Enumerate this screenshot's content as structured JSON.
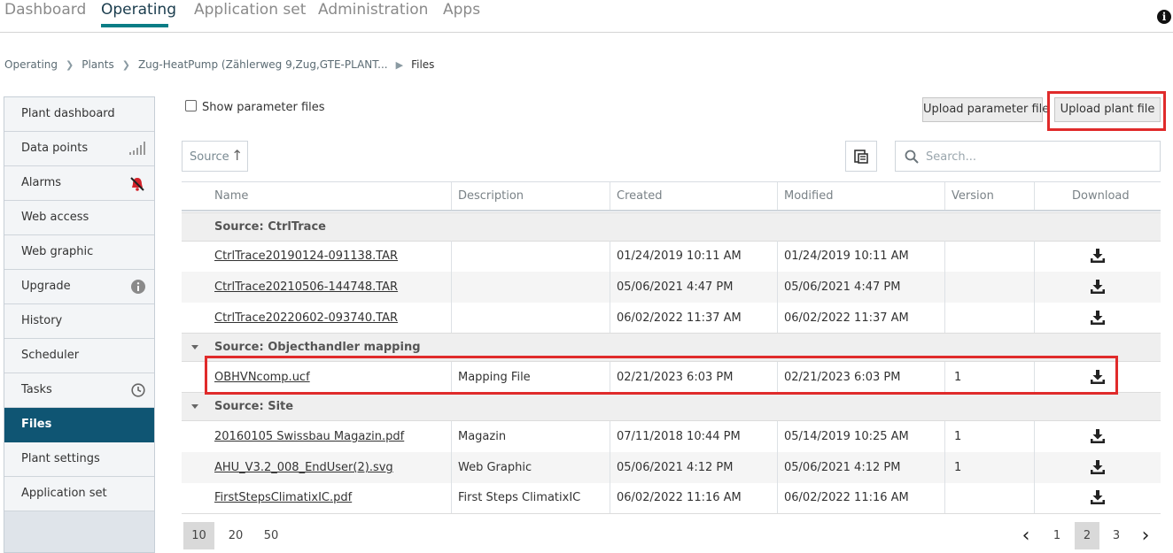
{
  "nav": {
    "tabs": [
      "Dashboard",
      "Operating",
      "Application set",
      "Administration",
      "Apps"
    ],
    "active": "Operating",
    "info_icon": "info-icon"
  },
  "breadcrumb": {
    "items": [
      "Operating",
      "Plants",
      "Zug-HeatPump (Zählerweg 9,Zug,GTE-PLANT..."
    ],
    "current": "Files"
  },
  "sidebar": {
    "items": [
      {
        "label": "Plant dashboard"
      },
      {
        "label": "Data points",
        "icon": "signal-bars-icon"
      },
      {
        "label": "Alarms",
        "icon": "muted-bell-icon"
      },
      {
        "label": "Web access"
      },
      {
        "label": "Web graphic"
      },
      {
        "label": "Upgrade",
        "icon": "info-icon"
      },
      {
        "label": "History"
      },
      {
        "label": "Scheduler"
      },
      {
        "label": "Tasks",
        "icon": "clock-icon"
      },
      {
        "label": "Files"
      },
      {
        "label": "Plant settings"
      },
      {
        "label": "Application set"
      }
    ],
    "active": "Files"
  },
  "toolbar": {
    "show_param_label": "Show parameter files",
    "upload_param_label": "Upload parameter file",
    "upload_plant_label": "Upload plant file",
    "source_label": "Source",
    "search_placeholder": "Search..."
  },
  "table": {
    "columns": [
      "Name",
      "Description",
      "Created",
      "Modified",
      "Version",
      "Download"
    ],
    "groups": [
      {
        "label": "Source: CtrlTrace",
        "rows": [
          {
            "name": "CtrlTrace20190124-091138.TAR",
            "description": "",
            "created": "01/24/2019 10:11 AM",
            "modified": "01/24/2019 10:11 AM",
            "version": ""
          },
          {
            "name": "CtrlTrace20210506-144748.TAR",
            "description": "",
            "created": "05/06/2021 4:47 PM",
            "modified": "05/06/2021 4:47 PM",
            "version": ""
          },
          {
            "name": "CtrlTrace20220602-093740.TAR",
            "description": "",
            "created": "06/02/2022 11:37 AM",
            "modified": "06/02/2022 11:37 AM",
            "version": ""
          }
        ]
      },
      {
        "label": "Source: Objecthandler mapping",
        "rows": [
          {
            "name": "OBHVNcomp.ucf",
            "description": "Mapping File",
            "created": "02/21/2023 6:03 PM",
            "modified": "02/21/2023 6:03 PM",
            "version": "1"
          }
        ]
      },
      {
        "label": "Source: Site",
        "rows": [
          {
            "name": "20160105 Swissbau Magazin.pdf",
            "description": "Magazin",
            "created": "07/11/2018 10:44 PM",
            "modified": "05/14/2019 10:25 AM",
            "version": "1"
          },
          {
            "name": "AHU_V3.2_008_EndUser(2).svg",
            "description": "Web Graphic",
            "created": "05/06/2021 4:12 PM",
            "modified": "05/06/2021 4:12 PM",
            "version": "1"
          },
          {
            "name": "FirstStepsClimatixIC.pdf",
            "description": "First Steps ClimatixIC",
            "created": "06/02/2022 11:16 AM",
            "modified": "06/02/2022 11:16 AM",
            "version": ""
          }
        ]
      }
    ]
  },
  "pagination": {
    "page_sizes": [
      "10",
      "20",
      "50"
    ],
    "selected_size": "10",
    "pages": [
      "1",
      "2",
      "3"
    ],
    "current_page": "2",
    "prev_icon": "chevron-left-icon",
    "next_icon": "chevron-right-icon"
  },
  "colors": {
    "accent": "#0a7d86",
    "sidebar_active": "#0f5573",
    "highlight": "#e02b2b"
  }
}
